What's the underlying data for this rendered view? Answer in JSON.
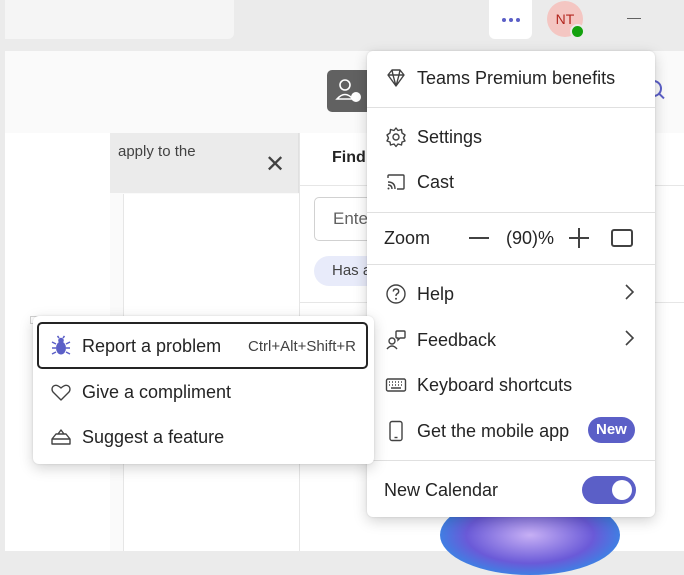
{
  "topbar": {
    "more_label": "More options",
    "avatar_initials": "NT"
  },
  "background": {
    "banner_text": "apply to the",
    "find_label": "Find",
    "enter_placeholder": "Ente",
    "pill_text": "Has a"
  },
  "menu": {
    "premium": "Teams Premium benefits",
    "settings": "Settings",
    "cast": "Cast",
    "zoom_label": "Zoom",
    "zoom_value": "(90)%",
    "help": "Help",
    "feedback": "Feedback",
    "keyboard_shortcuts": "Keyboard shortcuts",
    "mobile_app": "Get the mobile app",
    "mobile_badge": "New",
    "new_calendar": "New Calendar",
    "new_calendar_enabled": true
  },
  "submenu": {
    "report": "Report a problem",
    "report_shortcut": "Ctrl+Alt+Shift+R",
    "compliment": "Give a compliment",
    "suggest": "Suggest a feature"
  },
  "colors": {
    "accent": "#5b5fc7",
    "presence_available": "#13a10e"
  }
}
